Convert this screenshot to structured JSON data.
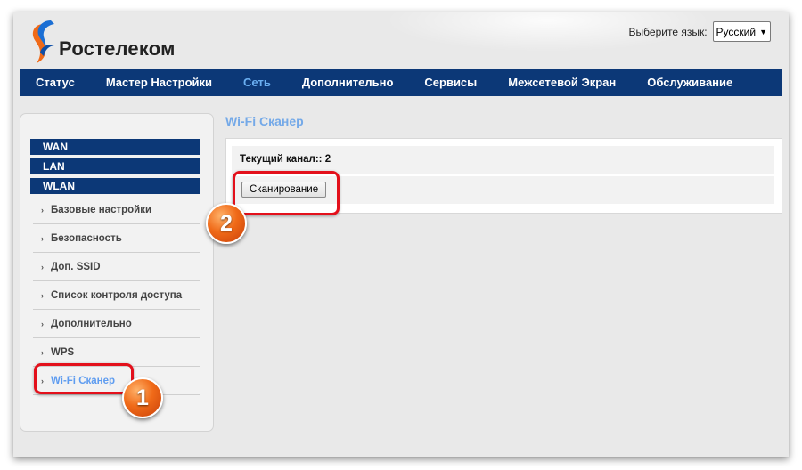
{
  "header": {
    "logo_text": "Ростелеком",
    "lang_label": "Выберите язык:",
    "lang_value": "Русский"
  },
  "nav": {
    "items": [
      "Статус",
      "Мастер Настройки",
      "Сеть",
      "Дополнительно",
      "Сервисы",
      "Межсетевой Экран",
      "Обслуживание"
    ],
    "active": "Сеть"
  },
  "sidebar": {
    "sections": [
      "WAN",
      "LAN",
      "WLAN"
    ],
    "items": [
      "Базовые настройки",
      "Безопасность",
      "Доп. SSID",
      "Список контроля доступа",
      "Дополнительно",
      "WPS",
      "Wi-Fi Сканер"
    ],
    "active": "Wi-Fi Сканер"
  },
  "content": {
    "title": "Wi-Fi Сканер",
    "channel_text": "Текущий канал:: 2",
    "scan_button": "Сканирование"
  },
  "annotations": {
    "badge1": "1",
    "badge2": "2"
  },
  "colors": {
    "nav_bg": "#0c3877",
    "nav_active": "#6aaef0",
    "title": "#74a9e8",
    "highlight": "#e3101b",
    "badge": "#f06a18"
  },
  "icons": [
    "rostelecom-logo-icon",
    "chevron-down-icon",
    "bullet-icon"
  ]
}
